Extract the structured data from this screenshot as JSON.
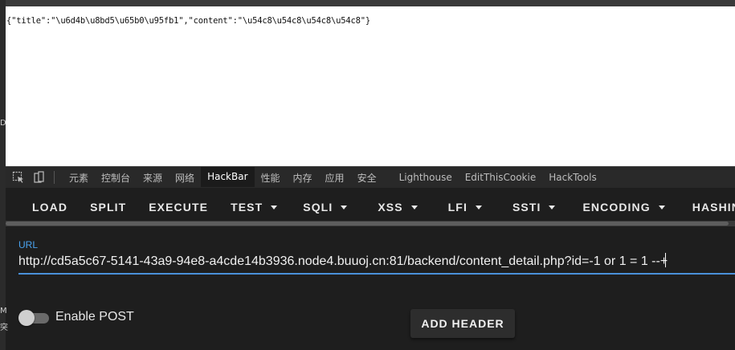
{
  "page": {
    "json_text": "{\"title\":\"\\u6d4b\\u8bd5\\u65b0\\u95fb1\",\"content\":\"\\u54c8\\u54c8\\u54c8\\u54c8\"}"
  },
  "left_fragments": [
    "D",
    "M",
    "突"
  ],
  "devtools": {
    "icons": [
      "element-picker-icon",
      "device-toolbar-icon"
    ],
    "tabs": [
      {
        "label": "元素"
      },
      {
        "label": "控制台"
      },
      {
        "label": "来源"
      },
      {
        "label": "网络"
      },
      {
        "label": "HackBar",
        "active": true
      },
      {
        "label": "性能"
      },
      {
        "label": "内存"
      },
      {
        "label": "应用"
      },
      {
        "label": "安全"
      },
      {
        "label": "Lighthouse"
      },
      {
        "label": "EditThisCookie"
      },
      {
        "label": "HackTools"
      }
    ]
  },
  "hackbar": {
    "buttons": [
      {
        "label": "LOAD"
      },
      {
        "label": "SPLIT"
      },
      {
        "label": "EXECUTE"
      },
      {
        "label": "TEST",
        "dropdown": true
      },
      {
        "label": "SQLI",
        "dropdown": true
      },
      {
        "label": "XSS",
        "dropdown": true
      },
      {
        "label": "LFI",
        "dropdown": true
      },
      {
        "label": "SSTI",
        "dropdown": true
      },
      {
        "label": "ENCODING",
        "dropdown": true
      },
      {
        "label": "HASHING",
        "dropdown": true
      }
    ],
    "url_label": "URL",
    "url_value": "http://cd5a5c67-5141-43a9-94e8-a4cde14b3936.node4.buuoj.cn:81/backend/content_detail.php?id=-1 or 1 = 1 --+",
    "enable_post_label": "Enable POST",
    "enable_post": false,
    "add_header_label": "ADD HEADER"
  },
  "colors": {
    "accent": "#4a90d9",
    "label_blue": "#4aa3ef",
    "panel_bg": "#1e1e1e"
  }
}
